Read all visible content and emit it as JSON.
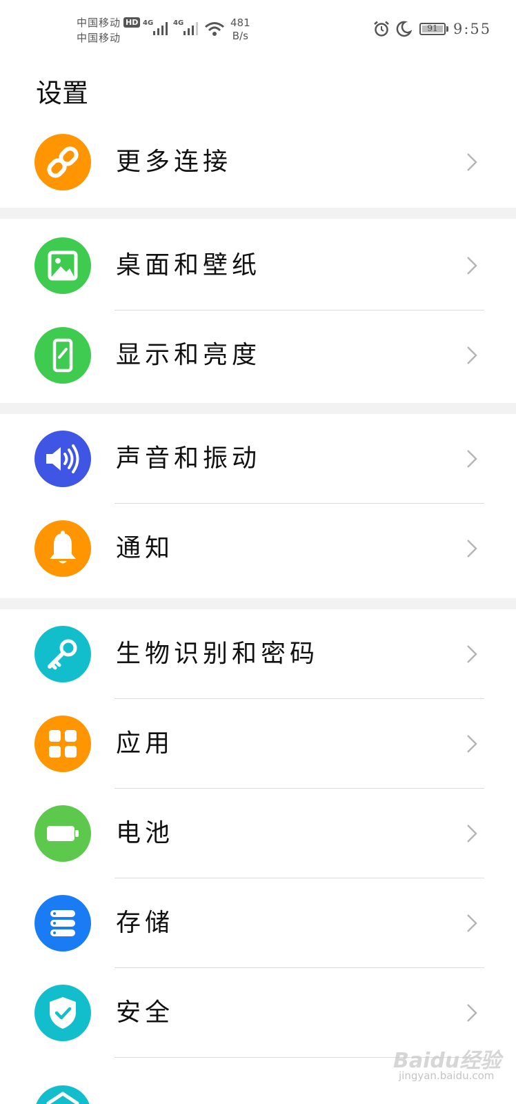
{
  "status_bar": {
    "carrier_1": "中国移动",
    "carrier_2": "中国移动",
    "hd_badge": "HD",
    "network_1": "4G",
    "network_2": "4G",
    "speed_value": "481",
    "speed_unit": "B/s",
    "battery_level": "91",
    "time": "9:55"
  },
  "page": {
    "title": "设置"
  },
  "settings_items": [
    {
      "label": "更多连接",
      "icon": "link-icon",
      "color": "#FF9500"
    },
    {
      "label": "桌面和壁纸",
      "icon": "image-icon",
      "color": "#3FCB50"
    },
    {
      "label": "显示和亮度",
      "icon": "phone-display-icon",
      "color": "#3FCB50"
    },
    {
      "label": "声音和振动",
      "icon": "speaker-icon",
      "color": "#3F55E3"
    },
    {
      "label": "通知",
      "icon": "bell-icon",
      "color": "#FF9500"
    },
    {
      "label": "生物识别和密码",
      "icon": "key-icon",
      "color": "#13BECC"
    },
    {
      "label": "应用",
      "icon": "apps-grid-icon",
      "color": "#FF9500"
    },
    {
      "label": "电池",
      "icon": "battery-icon",
      "color": "#5DC94C"
    },
    {
      "label": "存储",
      "icon": "storage-icon",
      "color": "#1A7CF5"
    },
    {
      "label": "安全",
      "icon": "shield-icon",
      "color": "#13BECC"
    }
  ],
  "watermark": {
    "brand": "Baidu经验",
    "site": "jingyan.baidu.com"
  }
}
